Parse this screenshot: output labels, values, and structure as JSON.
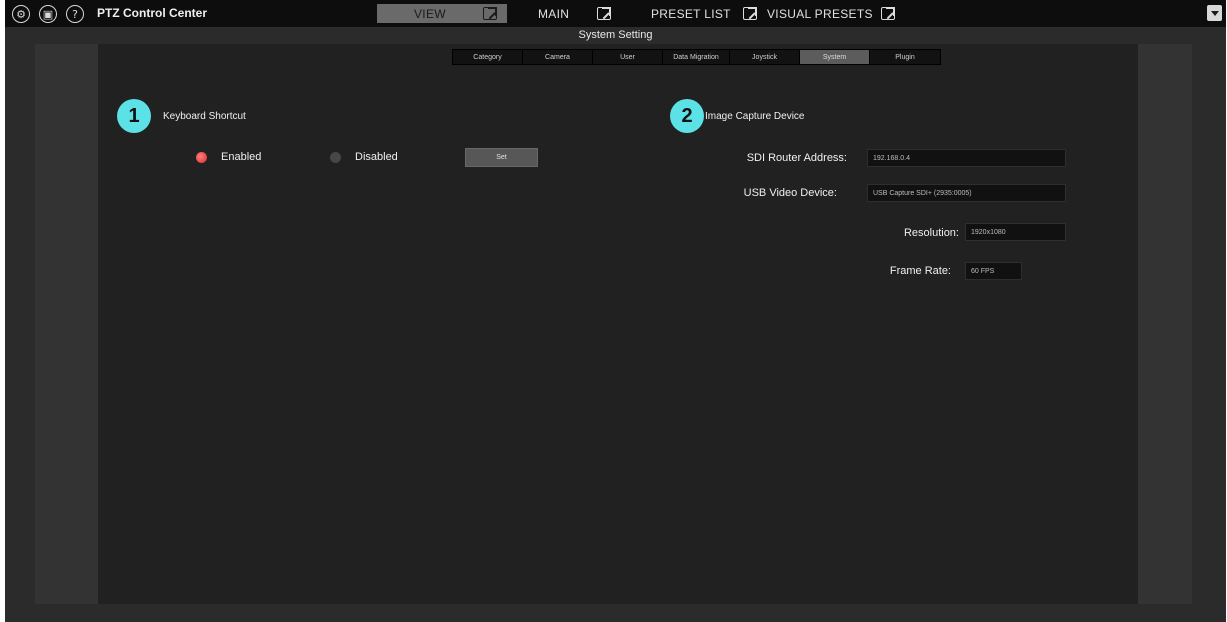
{
  "app": {
    "title": "PTZ Control Center",
    "icons": [
      "gear-icon",
      "camera-icon",
      "help-icon"
    ],
    "help_glyph": "?"
  },
  "nav": {
    "tabs": [
      {
        "label": "VIEW",
        "active": true
      },
      {
        "label": "MAIN",
        "active": false
      },
      {
        "label": "PRESET LIST",
        "active": false
      },
      {
        "label": "VISUAL PRESETS",
        "active": false
      }
    ]
  },
  "page": {
    "title": "System Setting"
  },
  "subtabs": [
    {
      "label": "Category",
      "active": false
    },
    {
      "label": "Camera",
      "active": false
    },
    {
      "label": "User",
      "active": false
    },
    {
      "label": "Data Migration",
      "active": false
    },
    {
      "label": "Joystick",
      "active": false
    },
    {
      "label": "System",
      "active": true
    },
    {
      "label": "Plugin",
      "active": false
    }
  ],
  "keyboard_shortcut": {
    "badge": "1",
    "title": "Keyboard Shortcut",
    "enabled_label": "Enabled",
    "disabled_label": "Disabled",
    "selected": "Enabled",
    "set_label": "Set"
  },
  "image_capture": {
    "badge": "2",
    "title": "Image Capture Device",
    "sdi_router_label": "SDI Router Address:",
    "sdi_router_value": "192.168.0.4",
    "usb_video_label": "USB Video Device:",
    "usb_video_value": "USB Capture SDI+ (2935:0005)",
    "resolution_label": "Resolution:",
    "resolution_value": "1920x1080",
    "frame_rate_label": "Frame Rate:",
    "frame_rate_value": "60 FPS"
  },
  "colors": {
    "badge": "#5ce1e6",
    "radio_on": "#e03030",
    "background": "#212121"
  }
}
